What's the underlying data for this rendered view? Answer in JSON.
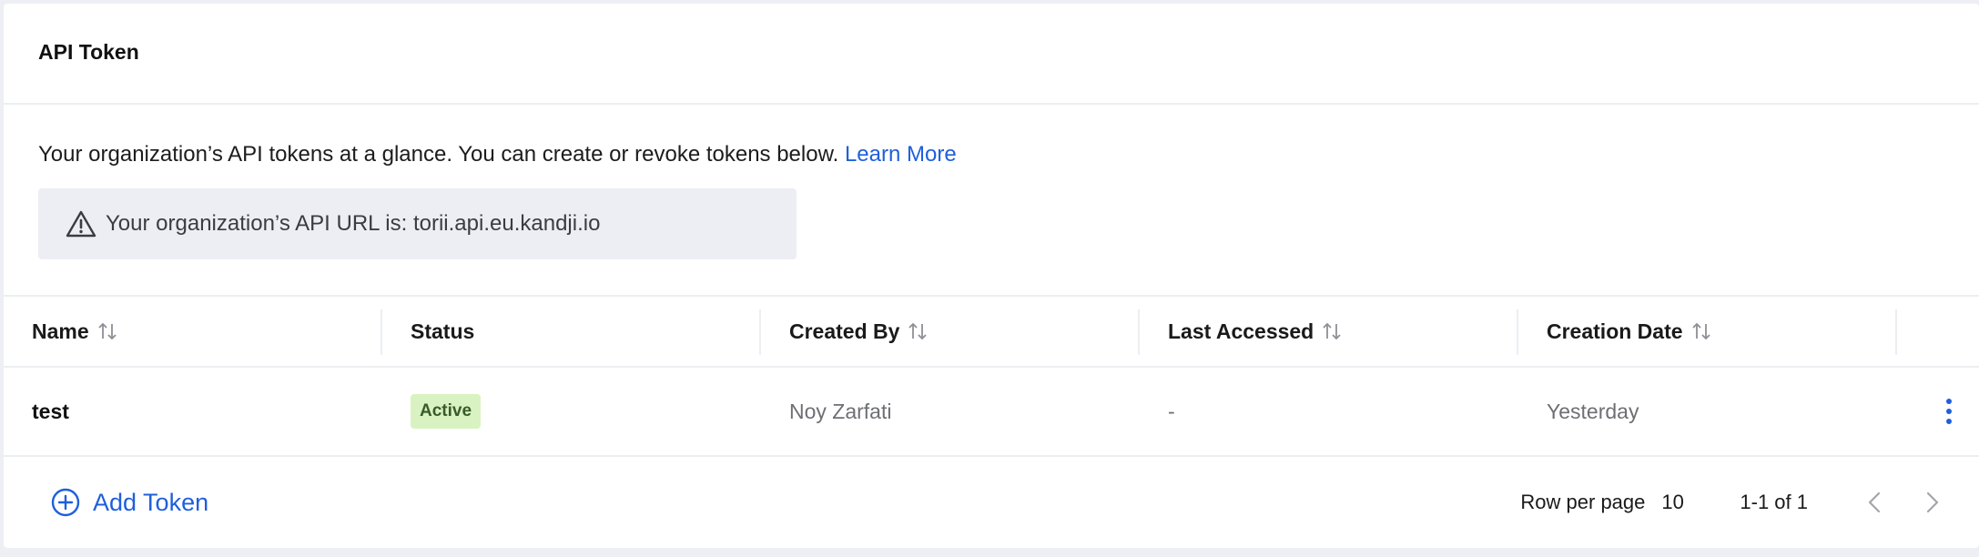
{
  "header": {
    "title": "API Token"
  },
  "intro": {
    "text": "Your organization’s API tokens at a glance. You can create or revoke tokens below.",
    "link_label": "Learn More"
  },
  "notice": {
    "icon": "warning-icon",
    "text": "Your organization’s API URL is: torii.api.eu.kandji.io"
  },
  "table": {
    "columns": [
      {
        "label": "Name",
        "sortable": true
      },
      {
        "label": "Status",
        "sortable": false
      },
      {
        "label": "Created By",
        "sortable": true
      },
      {
        "label": "Last Accessed",
        "sortable": true
      },
      {
        "label": "Creation Date",
        "sortable": true
      }
    ],
    "rows": [
      {
        "name": "test",
        "status": "Active",
        "created_by": "Noy Zarfati",
        "last_accessed": "-",
        "creation_date": "Yesterday",
        "actions_icon": "more-vertical-icon"
      }
    ]
  },
  "footer": {
    "add_token_label": "Add Token",
    "rows_per_page_label": "Row per page",
    "rows_per_page_value": "10",
    "range_text": "1-1 of 1"
  },
  "colors": {
    "accent": "#1f5fdc",
    "status_active_bg": "#d9f2c2",
    "notice_bg": "#eceef3"
  }
}
